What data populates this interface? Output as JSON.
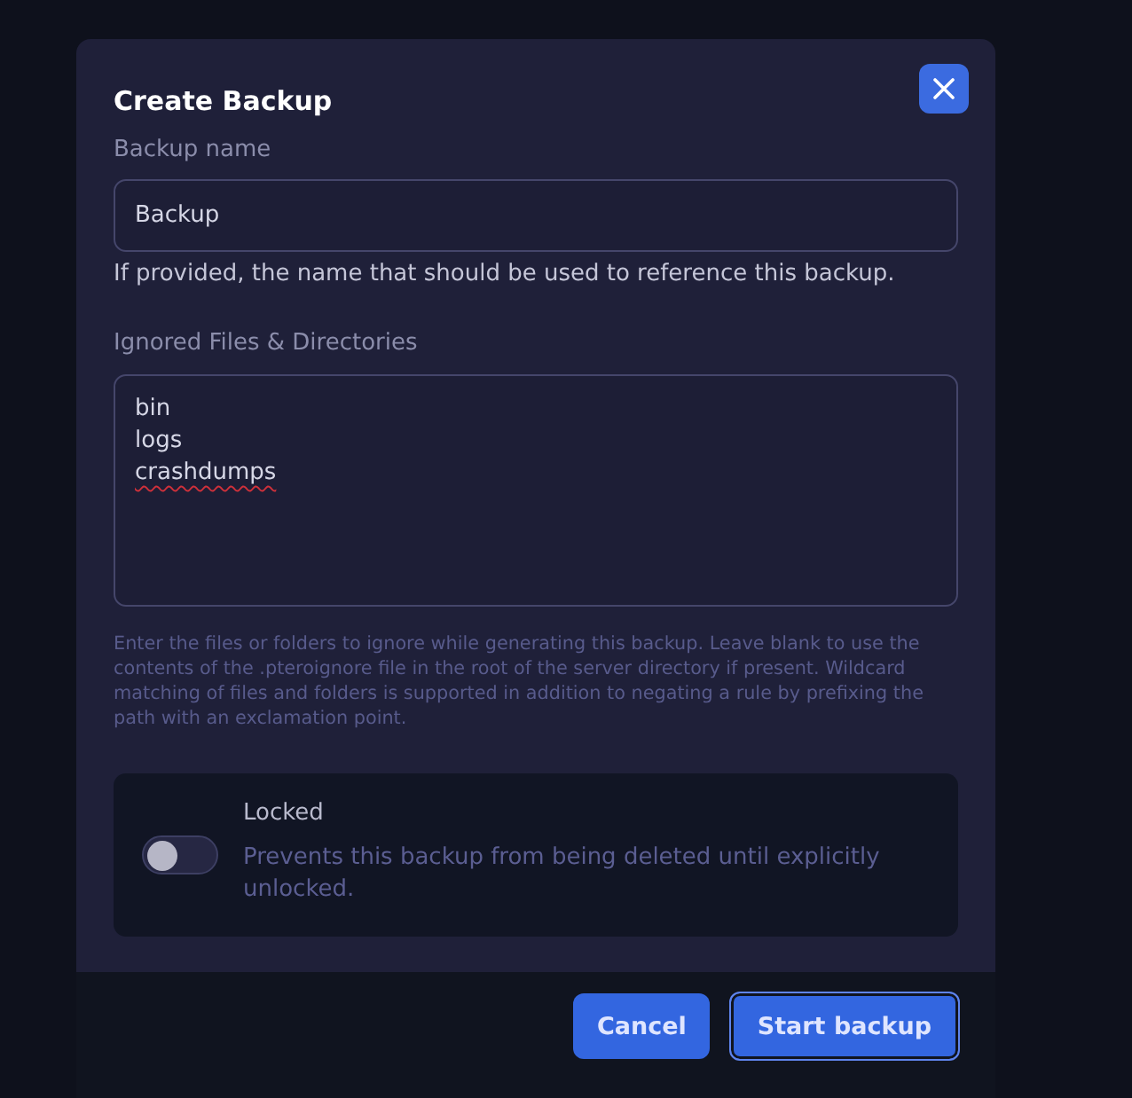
{
  "dialog": {
    "title": "Create Backup"
  },
  "backup_name": {
    "label": "Backup name",
    "value": "Backup",
    "help": "If provided, the name that should be used to reference this backup."
  },
  "ignored": {
    "label": "Ignored Files & Directories",
    "lines": [
      {
        "text": "bin",
        "misspelled": false
      },
      {
        "text": "logs",
        "misspelled": false
      },
      {
        "text": "crashdumps",
        "misspelled": true
      }
    ],
    "help": "Enter the files or folders to ignore while generating this backup. Leave blank to use the contents of the .pteroignore file in the root of the server directory if present. Wildcard matching of files and folders is supported in addition to negating a rule by prefixing the path with an exclamation point."
  },
  "locked": {
    "label": "Locked",
    "description": "Prevents this backup from being deleted until explicitly unlocked.",
    "on": false
  },
  "buttons": [
    {
      "label": "Cancel",
      "focused": false
    },
    {
      "label": "Start backup",
      "focused": true
    }
  ]
}
